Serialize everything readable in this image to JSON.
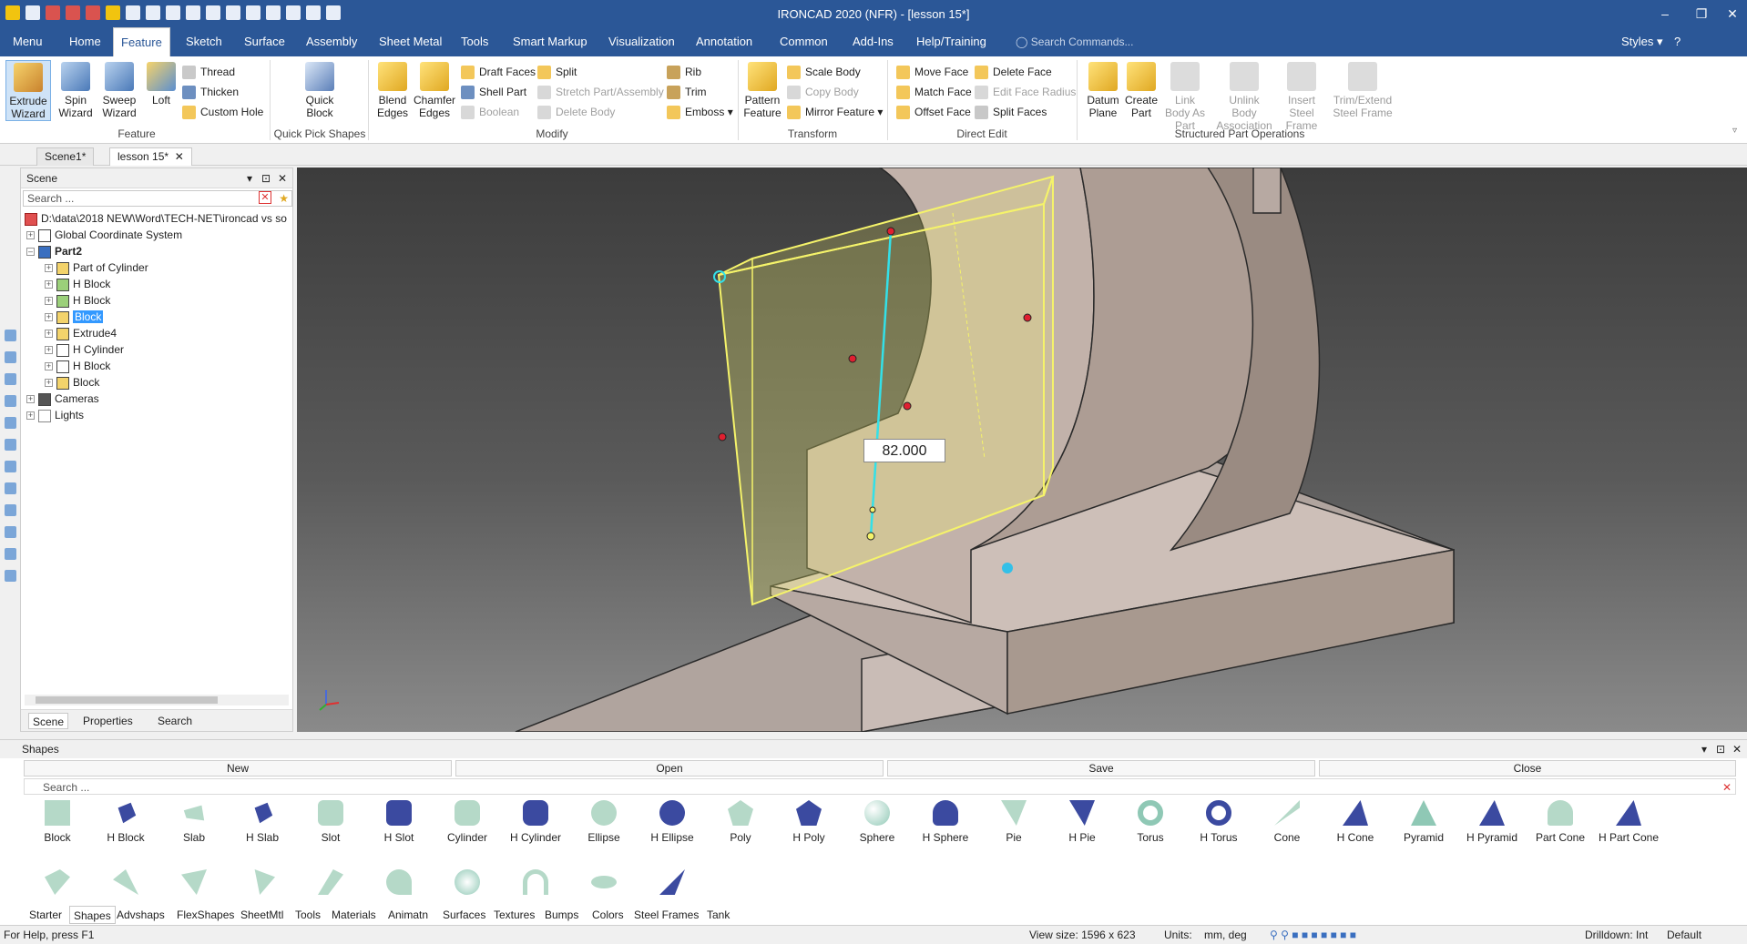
{
  "app": {
    "title": "IRONCAD 2020 (NFR) - [lesson 15*]",
    "styles_label": "Styles"
  },
  "menu_tabs": [
    "Menu",
    "Home",
    "Feature",
    "Sketch",
    "Surface",
    "Assembly",
    "Sheet Metal",
    "Tools",
    "Smart Markup",
    "Visualization",
    "Annotation",
    "Common",
    "Add-Ins",
    "Help/Training"
  ],
  "active_tab": "Feature",
  "command_search_placeholder": "Search Commands...",
  "ribbon": {
    "feature_group": {
      "label": "Feature",
      "extrude": "Extrude Wizard",
      "spin": "Spin Wizard",
      "sweep": "Sweep Wizard",
      "loft": "Loft",
      "thread": "Thread",
      "thicken": "Thicken",
      "custom_hole": "Custom Hole"
    },
    "quick_pick": {
      "label": "Quick Pick Shapes",
      "quick_block": "Quick Block"
    },
    "modify": {
      "label": "Modify",
      "blend": "Blend Edges",
      "chamfer": "Chamfer Edges",
      "draft_faces": "Draft Faces",
      "shell_part": "Shell Part",
      "boolean": "Boolean",
      "split": "Split",
      "stretch": "Stretch Part/Assembly",
      "delete_body": "Delete Body",
      "rib": "Rib",
      "trim": "Trim",
      "emboss": "Emboss"
    },
    "transform": {
      "label": "Transform",
      "pattern": "Pattern Feature",
      "scale_body": "Scale Body",
      "copy_body": "Copy Body",
      "mirror": "Mirror Feature"
    },
    "direct_edit": {
      "label": "Direct Edit",
      "move_face": "Move Face",
      "match_face": "Match Face",
      "offset_face": "Offset Face",
      "delete_face": "Delete Face",
      "edit_face_radius": "Edit Face Radius",
      "split_faces": "Split Faces"
    },
    "structured": {
      "label": "Structured Part Operations",
      "datum_plane": "Datum Plane",
      "create_part": "Create Part",
      "link_body": "Link Body As Part",
      "unlink_body": "Unlink Body Association",
      "insert_steel": "Insert Steel Frame",
      "trim_steel": "Trim/Extend Steel Frame"
    }
  },
  "doc_tabs": [
    "Scene1*",
    "lesson 15*"
  ],
  "scene_panel": {
    "title": "Scene",
    "search_placeholder": "Search ...",
    "root_path": "D:\\data\\2018 NEW\\Word\\TECH-NET\\ironcad vs so",
    "nodes": [
      {
        "label": "Global Coordinate System",
        "level": 1
      },
      {
        "label": "Part2",
        "level": 1,
        "bold": true
      },
      {
        "label": "Part of Cylinder",
        "level": 2
      },
      {
        "label": "H Block",
        "level": 2
      },
      {
        "label": "H Block",
        "level": 2
      },
      {
        "label": "Block",
        "level": 2,
        "selected": true
      },
      {
        "label": "Extrude4",
        "level": 2
      },
      {
        "label": "H Cylinder",
        "level": 2
      },
      {
        "label": "H Block",
        "level": 2
      },
      {
        "label": "Block",
        "level": 2
      },
      {
        "label": "Cameras",
        "level": 1
      },
      {
        "label": "Lights",
        "level": 1
      }
    ],
    "bottom_tabs": [
      "Scene",
      "Properties",
      "Search"
    ]
  },
  "viewport": {
    "dimension_value": "82.000"
  },
  "shapes_panel": {
    "title": "Shapes",
    "new_label": "New",
    "open_label": "Open",
    "save_label": "Save",
    "close_label": "Close",
    "search_placeholder": "Search ...",
    "items": [
      "Block",
      "H Block",
      "Slab",
      "H Slab",
      "Slot",
      "H Slot",
      "Cylinder",
      "H Cylinder",
      "Ellipse",
      "H Ellipse",
      "Poly",
      "H Poly",
      "Sphere",
      "H Sphere",
      "Pie",
      "H Pie",
      "Torus",
      "H Torus",
      "Cone",
      "H Cone",
      "Pyramid",
      "H Pyramid",
      "Part Cone",
      "H Part Cone"
    ],
    "catalog_tabs": [
      "Starter",
      "Shapes",
      "Advshaps",
      "FlexShapes",
      "SheetMtl",
      "Tools",
      "Materials",
      "Animatn",
      "Surfaces",
      "Textures",
      "Bumps",
      "Colors",
      "Steel Frames",
      "Tank"
    ],
    "active_catalog": "Shapes"
  },
  "status_bar": {
    "help": "For Help, press F1",
    "view_size": "View size: 1596 x  623",
    "units_label": "Units:",
    "units_value": "mm, deg",
    "drilldown": "Drilldown: Int",
    "mode": "Default"
  },
  "colors": {
    "accent": "#2b5797",
    "selection": "#3399ff",
    "highlight_box": "#f5f36a",
    "dimension_line": "#33e0e8"
  }
}
